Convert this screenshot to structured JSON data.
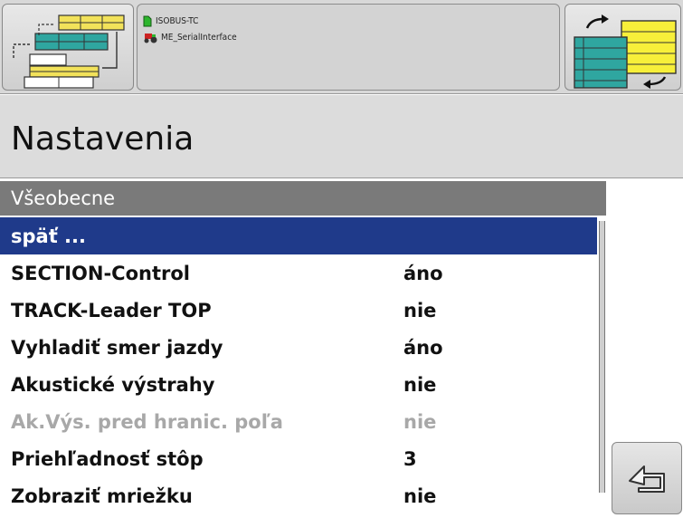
{
  "header": {
    "info_line_1": "ISOBUS-TC",
    "info_line_2": "ME_SerialInterface",
    "colors": {
      "yellow": "#f2e25a",
      "teal": "#2fa6a0",
      "icon_green": "#2db52d",
      "icon_red": "#cc2222"
    }
  },
  "page": {
    "title": "Nastavenia",
    "section_header": "Všeobecne"
  },
  "list": {
    "items": [
      {
        "label": "späť ...",
        "value": "",
        "state": "selected"
      },
      {
        "label": "SECTION-Control",
        "value": "áno",
        "state": "normal"
      },
      {
        "label": "TRACK-Leader TOP",
        "value": "nie",
        "state": "normal"
      },
      {
        "label": "Vyhladiť smer jazdy",
        "value": "áno",
        "state": "normal"
      },
      {
        "label": "Akustické výstrahy",
        "value": "nie",
        "state": "normal"
      },
      {
        "label": "Ak.Výs. pred hranic. poľa",
        "value": "nie",
        "state": "disabled"
      },
      {
        "label": "Priehľadnosť stôp",
        "value": "3",
        "state": "normal"
      },
      {
        "label": "Zobraziť mriežku",
        "value": "nie",
        "state": "normal"
      }
    ]
  },
  "icons": {
    "left_button": "field-layout-icon",
    "right_button": "swap-panels-icon",
    "back": "back-arrow-icon",
    "info_1": "document-icon",
    "info_2": "tractor-icon"
  },
  "colors": {
    "selected_row": "#1f3a8a",
    "section_header": "#7a7a7a",
    "disabled_text": "#a8a8a8"
  }
}
